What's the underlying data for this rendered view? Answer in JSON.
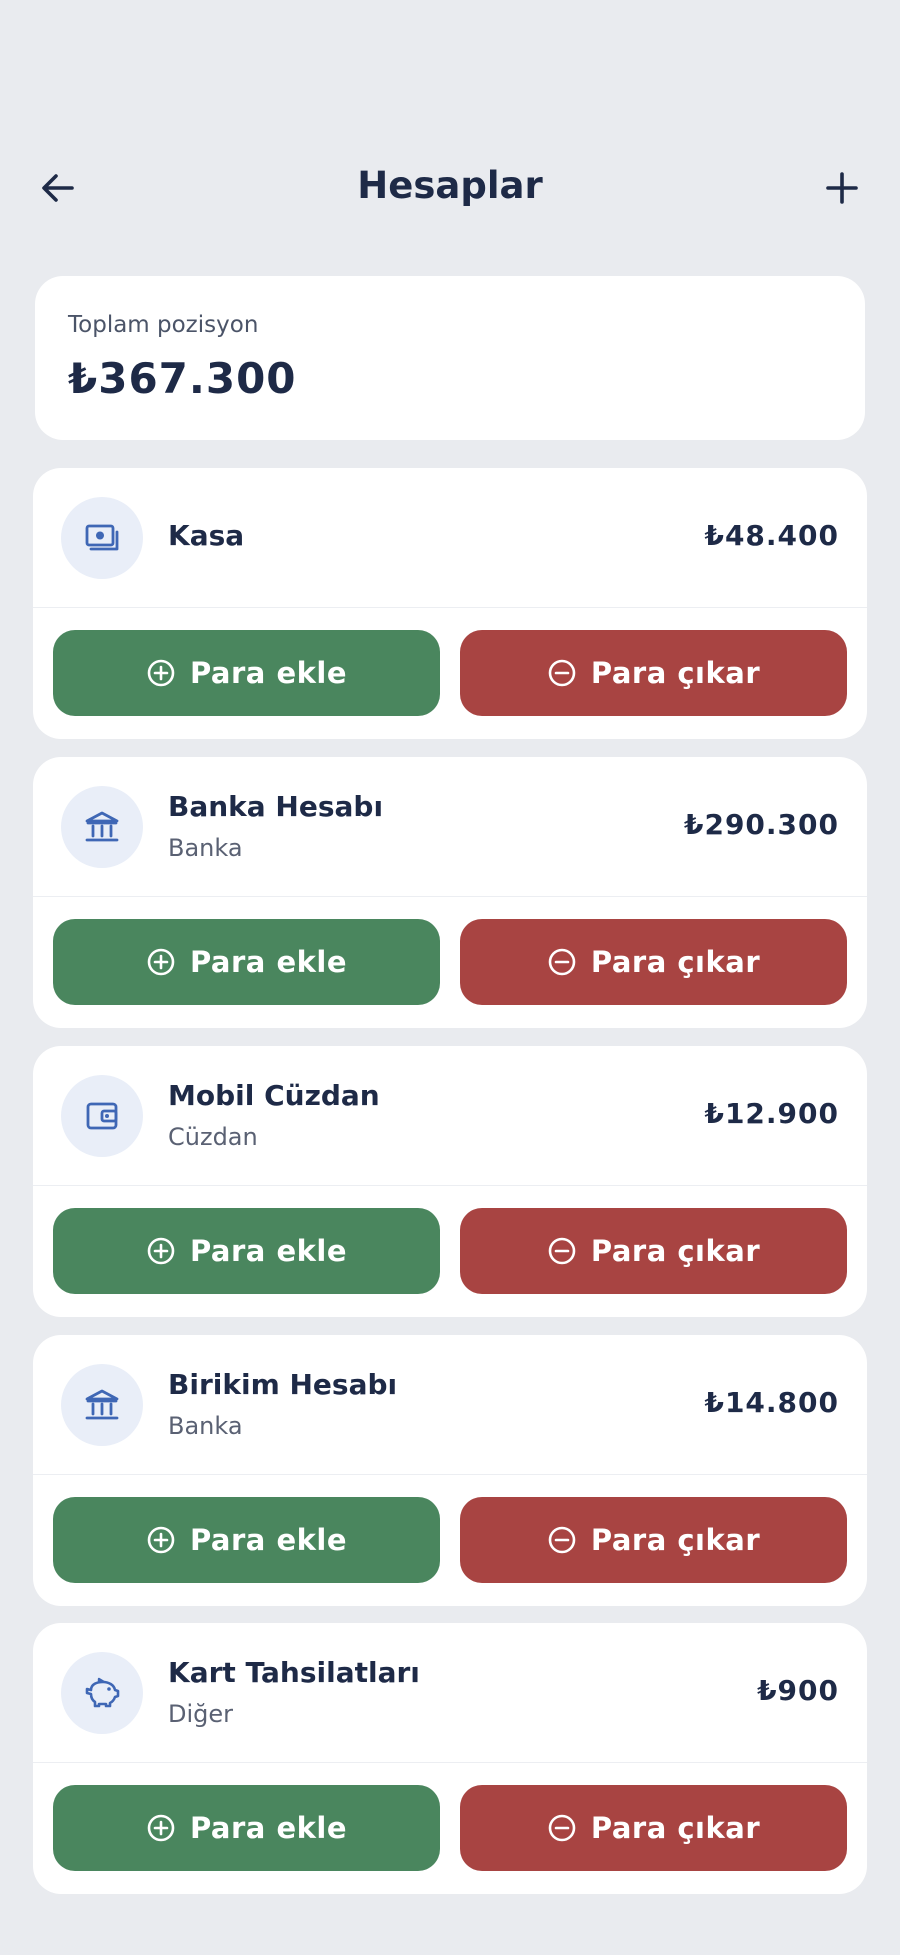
{
  "header": {
    "title": "Hesaplar"
  },
  "total": {
    "label": "Toplam pozisyon",
    "value": "₺367.300"
  },
  "actions": {
    "add_label": "Para ekle",
    "remove_label": "Para çıkar"
  },
  "accounts": [
    {
      "name": "Kasa",
      "type": "",
      "amount": "₺48.400",
      "icon": "cash-icon"
    },
    {
      "name": "Banka Hesabı",
      "type": "Banka",
      "amount": "₺290.300",
      "icon": "bank-icon"
    },
    {
      "name": "Mobil Cüzdan",
      "type": "Cüzdan",
      "amount": "₺12.900",
      "icon": "wallet-icon"
    },
    {
      "name": "Birikim Hesabı",
      "type": "Banka",
      "amount": "₺14.800",
      "icon": "bank-icon"
    },
    {
      "name": "Kart Tahsilatları",
      "type": "Diğer",
      "amount": "₺900",
      "icon": "piggy-bank-icon"
    }
  ],
  "colors": {
    "add": "#4a865e",
    "remove": "#a84442",
    "background": "#e9ebef",
    "icon": "#3f67b5"
  }
}
